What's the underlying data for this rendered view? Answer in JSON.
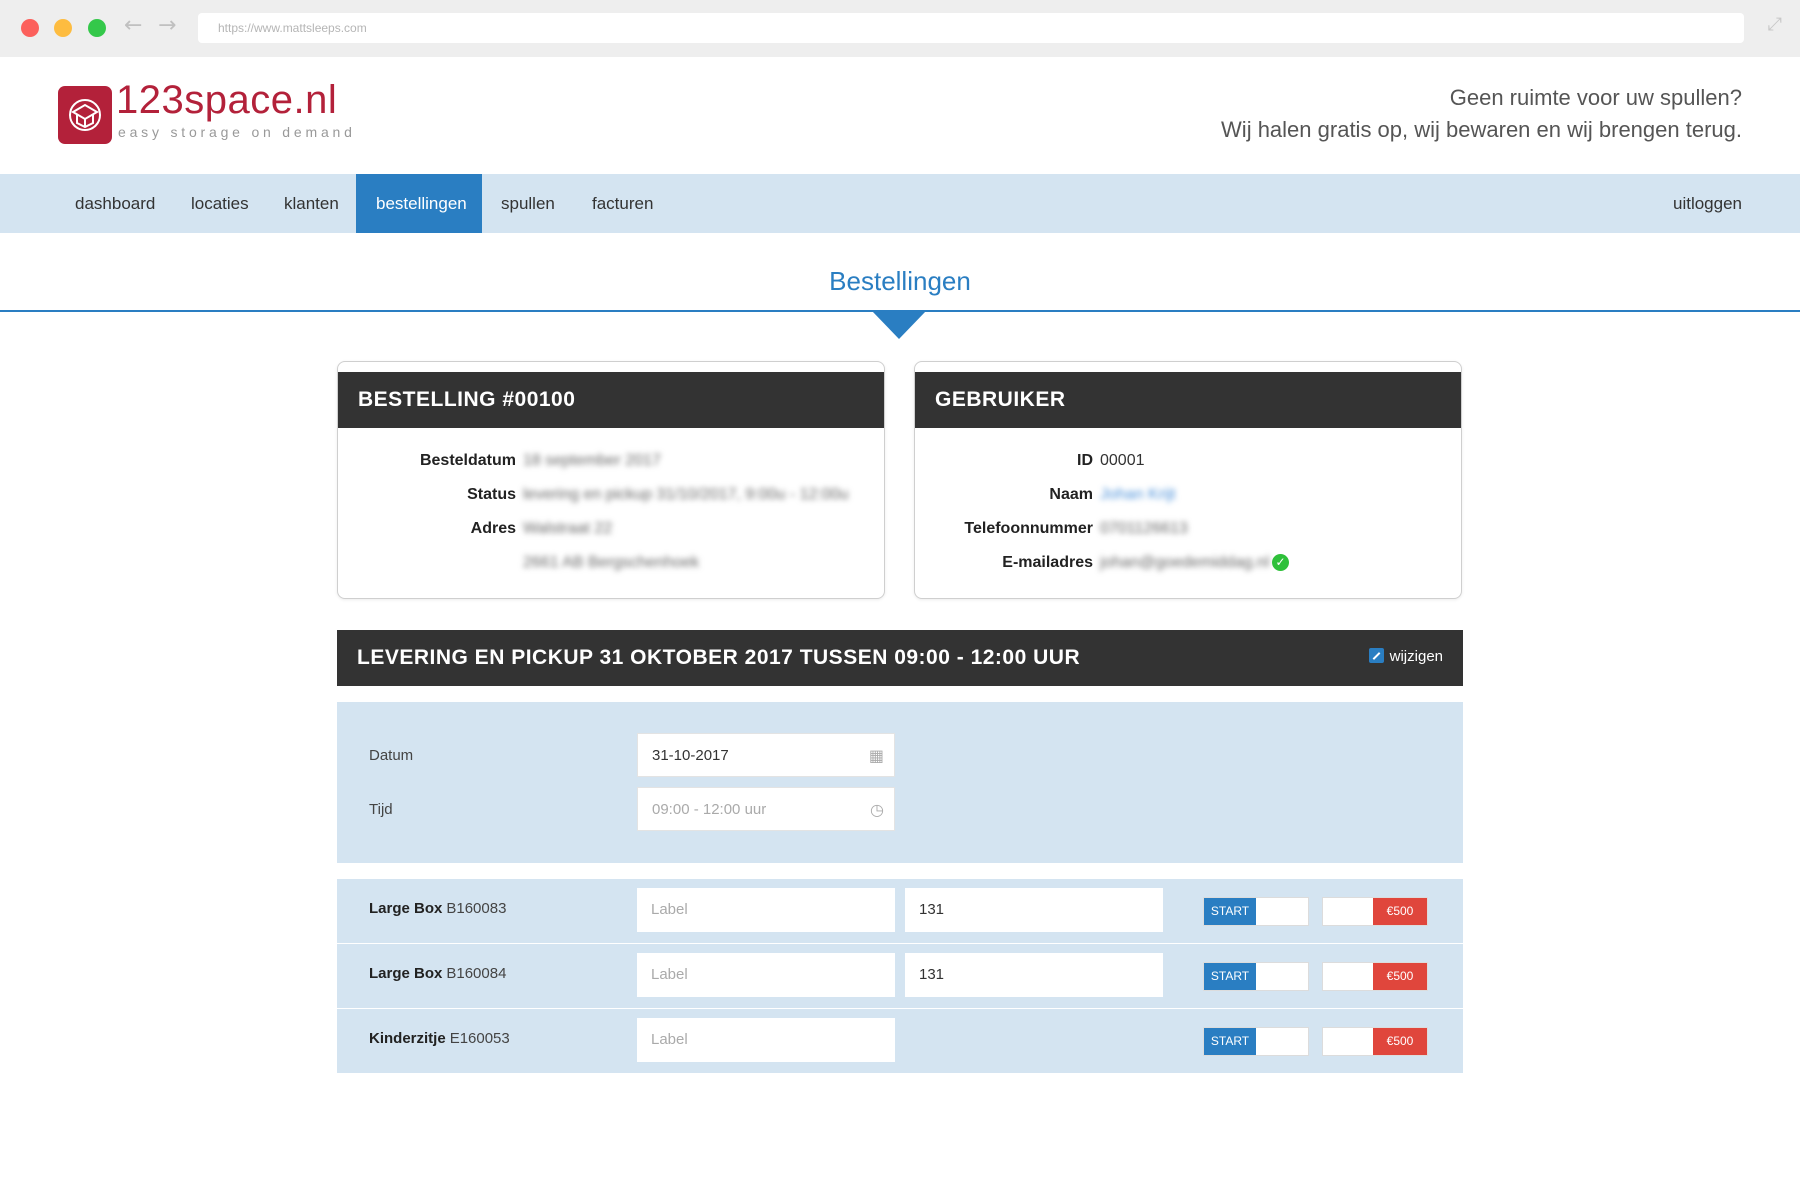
{
  "browser": {
    "url": "https://www.mattsleeps.com"
  },
  "header": {
    "logo_text": "123space.nl",
    "logo_tagline": "easy storage on demand",
    "slogan_line1": "Geen ruimte voor uw spullen?",
    "slogan_line2": "Wij halen gratis op, wij bewaren en wij brengen terug."
  },
  "nav": {
    "items": [
      {
        "label": "dashboard"
      },
      {
        "label": "locaties"
      },
      {
        "label": "klanten"
      },
      {
        "label": "bestellingen"
      },
      {
        "label": "spullen"
      },
      {
        "label": "facturen"
      }
    ],
    "active": "bestellingen",
    "logout": "uitloggen"
  },
  "page": {
    "title": "Bestellingen"
  },
  "order_card": {
    "title": "BESTELLING #00100",
    "fields": [
      {
        "label": "Besteldatum",
        "value": "18 september 2017"
      },
      {
        "label": "Status",
        "value": "levering en pickup 31/10/2017, 9:00u - 12:00u"
      },
      {
        "label": "Adres",
        "value": "Walstraat 22"
      },
      {
        "label": "",
        "value": "2661 AB Bergschenhoek"
      }
    ]
  },
  "user_card": {
    "title": "GEBRUIKER",
    "fields": [
      {
        "label": "ID",
        "value": "00001"
      },
      {
        "label": "Naam",
        "value": "Johan Krijt"
      },
      {
        "label": "Telefoonnummer",
        "value": "0701126613"
      },
      {
        "label": "E-mailadres",
        "value": "johan@goedemiddag.nl"
      }
    ]
  },
  "delivery": {
    "title": "LEVERING EN PICKUP 31 OKTOBER 2017 TUSSEN 09:00 - 12:00 UUR",
    "edit_label": "wijzigen",
    "date_label": "Datum",
    "date_value": "31-10-2017",
    "time_label": "Tijd",
    "time_placeholder": "09:00 - 12:00 uur"
  },
  "items": [
    {
      "name": "Large Box",
      "code": "B160083",
      "label_placeholder": "Label",
      "number": "131",
      "start": "START",
      "price": "€500"
    },
    {
      "name": "Large Box",
      "code": "B160084",
      "label_placeholder": "Label",
      "number": "131",
      "start": "START",
      "price": "€500"
    },
    {
      "name": "Kinderzitje",
      "code": "E160053",
      "label_placeholder": "Label",
      "number": "",
      "start": "START",
      "price": "€500"
    }
  ],
  "colors": {
    "brand": "#b3213a",
    "accent": "#2a7ec2",
    "panel": "#d4e4f1",
    "header_bar": "#333333",
    "danger": "#e0463c",
    "success": "#2ec03a"
  },
  "icons": {
    "browser_back": "back-arrow-icon",
    "browser_forward": "forward-arrow-icon",
    "browser_expand": "expand-icon",
    "logo": "storage-box-icon",
    "edit": "edit-icon",
    "calendar": "calendar-icon",
    "clock": "clock-icon",
    "verified": "check-circle-icon"
  }
}
